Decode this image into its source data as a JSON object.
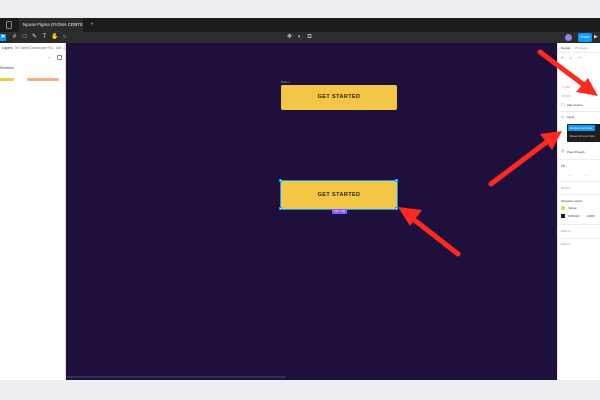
{
  "window": {
    "tab_title": "Npose Figma (FIGMA CENTER)",
    "tab_close": "×",
    "new_tab": "+"
  },
  "toolbar": {
    "share_label": "Share",
    "play_icon": "▶"
  },
  "left_panel": {
    "tab_layers": "Layers",
    "tab_page": "Tél Tablet Dashboard Fa... (de...)",
    "section": "Elements",
    "add_icon": "+"
  },
  "canvas": {
    "top_button_label": "GET STARTED",
    "top_frame_label": "Button",
    "selected_button_label": "GET STARTED",
    "size_badge": "116 × 28",
    "background": "#1f0f3d",
    "button_color": "#f4c648"
  },
  "right_panel": {
    "tab_design": "Design",
    "tab_prototype": "Prototype",
    "clip_content": "Clip content",
    "layer_section": "Layer",
    "dropdown_selected": "Default Hebrews",
    "dropdown_other": "Reset all overrides",
    "pass_through": "Pass through",
    "fill_section": "Fill",
    "stroke_section": "Stroke",
    "selection_colors": "Selection colors",
    "color_1_name": "Yellow",
    "color_2_hex": "1D1D1D",
    "color_2_opacity": "100%",
    "effects_section": "Effects",
    "export_section": "Export"
  },
  "colors": {
    "accent": "#0d99ff",
    "arrow": "#ff2a1f",
    "swatch_yellow": "#f4c648",
    "swatch_dark": "#1d1d1d"
  }
}
